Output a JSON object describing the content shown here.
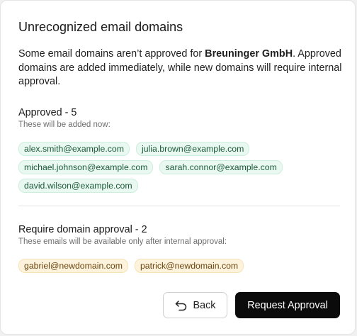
{
  "dialog": {
    "title": "Unrecognized email domains",
    "description_prefix": "Some email domains aren’t approved for ",
    "organization": "Breuninger GmbH",
    "description_suffix": ". Approved domains are added immediately, while new domains will require internal approval."
  },
  "approved": {
    "title": "Approved - 5",
    "subtitle": "These will be added now:",
    "emails": [
      "alex.smith@example.com",
      "julia.brown@example.com",
      "michael.johnson@example.com",
      "sarah.connor@example.com",
      "david.wilson@example.com"
    ]
  },
  "pending": {
    "title": "Require domain approval - 2",
    "subtitle": "These emails will be available only after internal approval:",
    "emails": [
      "gabriel@newdomain.com",
      "patrick@newdomain.com"
    ]
  },
  "actions": {
    "back_label": "Back",
    "back_icon": "undo-arrow-icon",
    "primary_label": "Request Approval"
  },
  "colors": {
    "approved_chip_bg": "#e9f8f0",
    "approved_chip_text": "#1d5a3a",
    "pending_chip_bg": "#fdf3dc",
    "pending_chip_text": "#6b4510",
    "primary_button_bg": "#0b0b0b"
  }
}
